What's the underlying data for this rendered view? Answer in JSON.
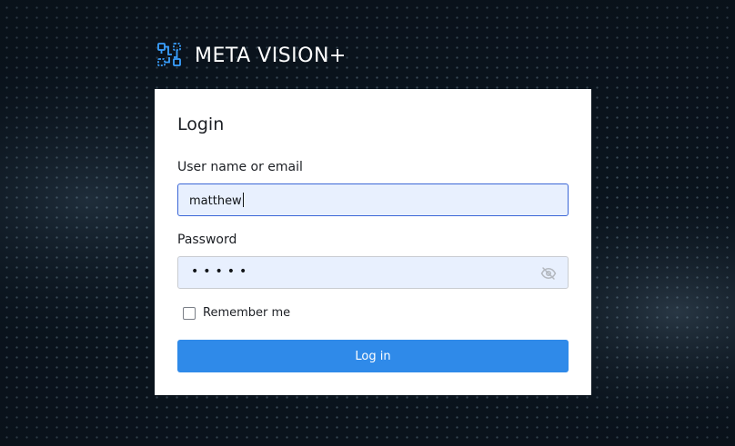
{
  "brand": {
    "name": "META VISION+",
    "icon": "meta-vision-logo-icon",
    "accent_color": "#3aa0ff"
  },
  "login_form": {
    "title": "Login",
    "username": {
      "label": "User name or email",
      "value": "matthew"
    },
    "password": {
      "label": "Password",
      "masked_value": "•••••",
      "toggle_icon": "eye-off-icon"
    },
    "remember_me": {
      "label": "Remember me",
      "checked": false
    },
    "submit": {
      "label": "Log in",
      "color": "#2f8ae9"
    }
  }
}
